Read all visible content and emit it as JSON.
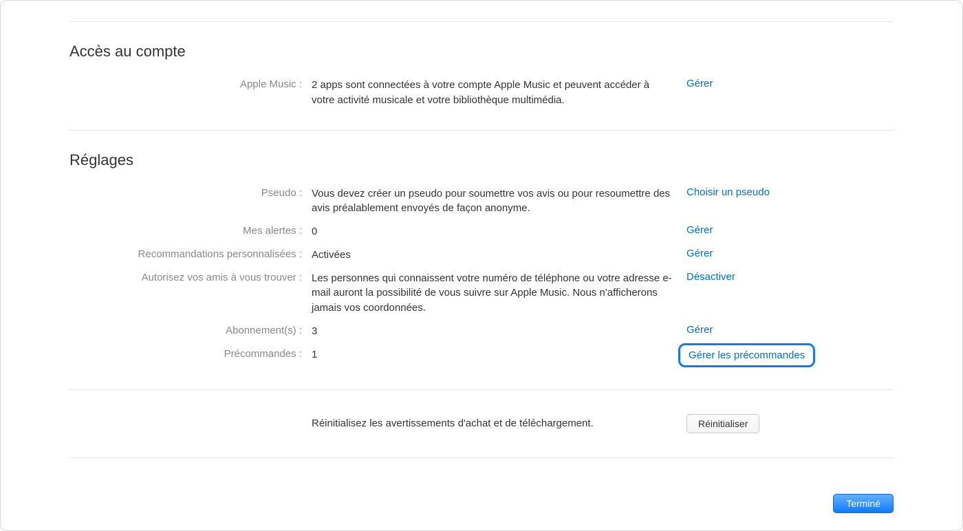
{
  "access": {
    "title": "Accès au compte",
    "apple_music": {
      "label": "Apple Music :",
      "value": "2 apps sont connectées à votre compte Apple Music et peuvent accéder à votre activité musicale et votre bibliothèque multimédia.",
      "action": "Gérer"
    }
  },
  "settings": {
    "title": "Réglages",
    "pseudo": {
      "label": "Pseudo :",
      "value": "Vous devez créer un pseudo pour soumettre vos avis ou pour resoumettre des avis préalablement envoyés de façon anonyme.",
      "action": "Choisir un pseudo"
    },
    "alerts": {
      "label": "Mes alertes :",
      "value": "0",
      "action": "Gérer"
    },
    "recommendations": {
      "label": "Recommandations personnalisées :",
      "value": "Activées",
      "action": "Gérer"
    },
    "friends": {
      "label": "Autorisez vos amis à vous trouver :",
      "value": "Les personnes qui connaissent votre numéro de téléphone ou votre adresse e-mail auront la possibilité de vous suivre sur Apple Music. Nous n'afficherons jamais vos coordonnées.",
      "action": "Désactiver"
    },
    "subscriptions": {
      "label": "Abonnement(s) :",
      "value": "3",
      "action": "Gérer"
    },
    "preorders": {
      "label": "Précommandes :",
      "value": "1",
      "action": "Gérer les précommandes"
    }
  },
  "reset": {
    "text": "Réinitialisez les avertissements d'achat et de téléchargement.",
    "button": "Réinitialiser"
  },
  "footer": {
    "done": "Terminé"
  }
}
